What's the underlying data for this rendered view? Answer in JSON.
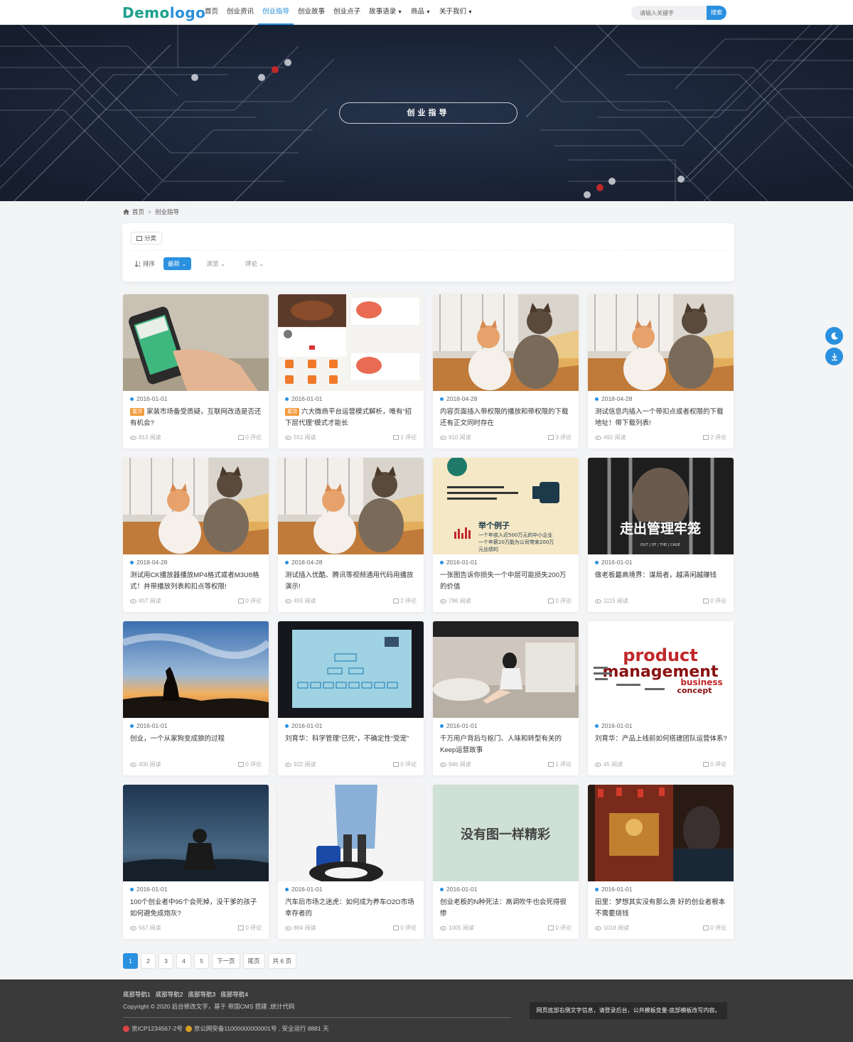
{
  "header": {
    "logo_part1": "Demo",
    "logo_part2": "logo",
    "nav": [
      {
        "label": "首页",
        "dropdown": false,
        "active": false
      },
      {
        "label": "创业资讯",
        "dropdown": false,
        "active": false
      },
      {
        "label": "创业指导",
        "dropdown": false,
        "active": true
      },
      {
        "label": "创业故事",
        "dropdown": false,
        "active": false
      },
      {
        "label": "创业点子",
        "dropdown": false,
        "active": false
      },
      {
        "label": "故事语录",
        "dropdown": true,
        "active": false
      },
      {
        "label": "商品",
        "dropdown": true,
        "active": false
      },
      {
        "label": "关于我们",
        "dropdown": true,
        "active": false
      }
    ],
    "search_placeholder": "请输入关键字",
    "search_button": "搜索"
  },
  "banner": {
    "title": "创业指导"
  },
  "breadcrumb": {
    "home": "首页",
    "current": "创业指导"
  },
  "filter": {
    "category_label": "分类",
    "sort_label": "排序",
    "sort_options": [
      {
        "label": "最新",
        "active": true
      },
      {
        "label": "浏览",
        "active": false
      },
      {
        "label": "评论",
        "active": false
      }
    ]
  },
  "cards": [
    {
      "date": "2016-01-01",
      "badge": "置顶",
      "title": "家装市场备受质疑，互联网改造是否还有机会?",
      "views": "813 阅读",
      "comments": "0 评论",
      "thumb": "phone"
    },
    {
      "date": "2016-01-01",
      "badge": "置顶",
      "title": "六大微商平台运营模式解析，唯有“招下层代理”模式才能长",
      "views": "551 阅读",
      "comments": "1 评论",
      "thumb": "food"
    },
    {
      "date": "2018-04-28",
      "badge": "",
      "title": "内容页面插入带权限的播放和带权限的下载还有正文同时存在",
      "views": "910 阅读",
      "comments": "3 评论",
      "thumb": "cats"
    },
    {
      "date": "2018-04-28",
      "badge": "",
      "title": "测试信息内插入一个带扣点或者权限的下载地址！带下载列表!",
      "views": "492 阅读",
      "comments": "2 评论",
      "thumb": "cats"
    },
    {
      "date": "2018-04-28",
      "badge": "",
      "title": "测试用CK播放器播放MP4格式或者M3U8格式！并带播放列表和扣点等权限!",
      "views": "457 阅读",
      "comments": "0 评论",
      "thumb": "cats"
    },
    {
      "date": "2018-04-28",
      "badge": "",
      "title": "测试插入优酷、腾讯等视频通用代码用播放演示!",
      "views": "455 阅读",
      "comments": "2 评论",
      "thumb": "cats"
    },
    {
      "date": "2016-01-01",
      "badge": "",
      "title": "一张图告诉你损失一个中层可能损失200万的价值",
      "views": "796 阅读",
      "comments": "0 评论",
      "thumb": "poster"
    },
    {
      "date": "2016-01-01",
      "badge": "",
      "title": "做老板最高境界：谋局者，越清闲越赚钱",
      "views": "1115 阅读",
      "comments": "0 评论",
      "thumb": "cage"
    },
    {
      "date": "2016-01-01",
      "badge": "",
      "title": "创业，一个从家狗变成狼的过程",
      "views": "400 阅读",
      "comments": "0 评论",
      "thumb": "wolf"
    },
    {
      "date": "2016-01-01",
      "badge": "",
      "title": "刘育华：科学管理“已死”，不确定性“受宠”",
      "views": "922 阅读",
      "comments": "0 评论",
      "thumb": "screen"
    },
    {
      "date": "2016-01-01",
      "badge": "",
      "title": "千万用户背后与抠门、人味和转型有关的Keep运营故事",
      "views": "946 阅读",
      "comments": "1 评论",
      "thumb": "room"
    },
    {
      "date": "2016-01-01",
      "badge": "",
      "title": "刘育华：产品上线前如何搭建团队运营体系?",
      "views": "45 阅读",
      "comments": "0 评论",
      "thumb": "words"
    },
    {
      "date": "2016-01-01",
      "badge": "",
      "title": "100个创业者中95个会死掉，没干爹的孩子如何避免成炮灰?",
      "views": "567 阅读",
      "comments": "0 评论",
      "thumb": "soldier"
    },
    {
      "date": "2016-01-01",
      "badge": "",
      "title": "汽车后市场之迷虎：如何成为养车O2O市场幸存者的",
      "views": "864 阅读",
      "comments": "0 评论",
      "thumb": "tire"
    },
    {
      "date": "2016-01-01",
      "badge": "",
      "title": "创业老板的N种死法：高调吹牛也会死得很惨",
      "views": "1005 阅读",
      "comments": "0 评论",
      "thumb": "noimg"
    },
    {
      "date": "2016-01-01",
      "badge": "",
      "title": "田里：梦想其实没有那么贵 好的创业者根本不需要烧钱",
      "views": "1018 阅读",
      "comments": "0 评论",
      "thumb": "temple"
    }
  ],
  "thumb_text": {
    "noimg": "没有图一样精彩",
    "cage_title": "走出管理牢笼",
    "cage_sub": "OUT | OF | THE | CAGE",
    "words_1": "product",
    "words_2": "management",
    "words_3": "business",
    "words_4": "concept",
    "poster_1": "举个例子",
    "poster_2": "一个年收入近500万元的中小企业",
    "poster_3": "一个年薪20万能为公司带来200万",
    "poster_4": "元业绩的"
  },
  "pagination": {
    "pages": [
      "1",
      "2",
      "3",
      "4",
      "5"
    ],
    "current": "1",
    "next": "下一页",
    "last": "尾页",
    "total": "共 6 页"
  },
  "footer": {
    "links": [
      "底部导航1",
      "底部导航2",
      "底部导航3",
      "底部导航4"
    ],
    "copyright": "Copyright © 2020 后台修改文字，基于 帝国CMS 搭建 ,统计代码",
    "icp": "京ICP1234567-2号",
    "police": "京公网安备11000000000001号 , 安全运行 8881 天",
    "note": "网页底部右侧文字信息，请登录后台，公共模板变量-底部模板改写内容。"
  },
  "colors": {
    "accent": "#2a90e0",
    "banner_bg": "#1c2538",
    "badge": "#f39a3a",
    "footer_bg": "#3a3a3a"
  }
}
